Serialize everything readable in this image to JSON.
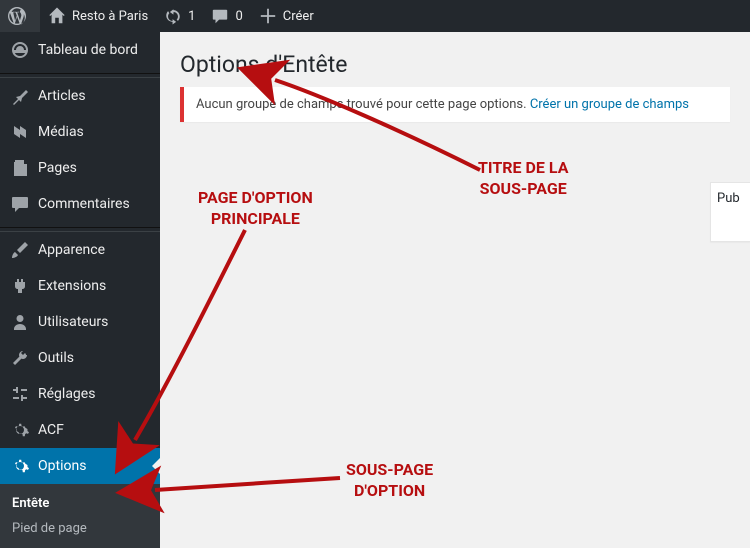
{
  "adminbar": {
    "site_name": "Resto à Paris",
    "updates": "1",
    "comments": "0",
    "new_label": "Créer"
  },
  "sidebar": {
    "dashboard": "Tableau de bord",
    "posts": "Articles",
    "media": "Médias",
    "pages": "Pages",
    "comments": "Commentaires",
    "appearance": "Apparence",
    "plugins": "Extensions",
    "users": "Utilisateurs",
    "tools": "Outils",
    "settings": "Réglages",
    "acf": "ACF",
    "options": "Options",
    "submenu": {
      "entete": "Entête",
      "pied": "Pied de page"
    }
  },
  "content": {
    "title": "Options d'Entête",
    "notice_text": "Aucun groupe de champs trouvé pour cette page options. ",
    "notice_link": "Créer un groupe de champs",
    "sidepanel": "Pub"
  },
  "annotations": {
    "anno1": "TITRE DE LA\nSOUS-PAGE",
    "anno2": "PAGE D'OPTION\nPRINCIPALE",
    "anno3": "SOUS-PAGE\nD'OPTION"
  }
}
